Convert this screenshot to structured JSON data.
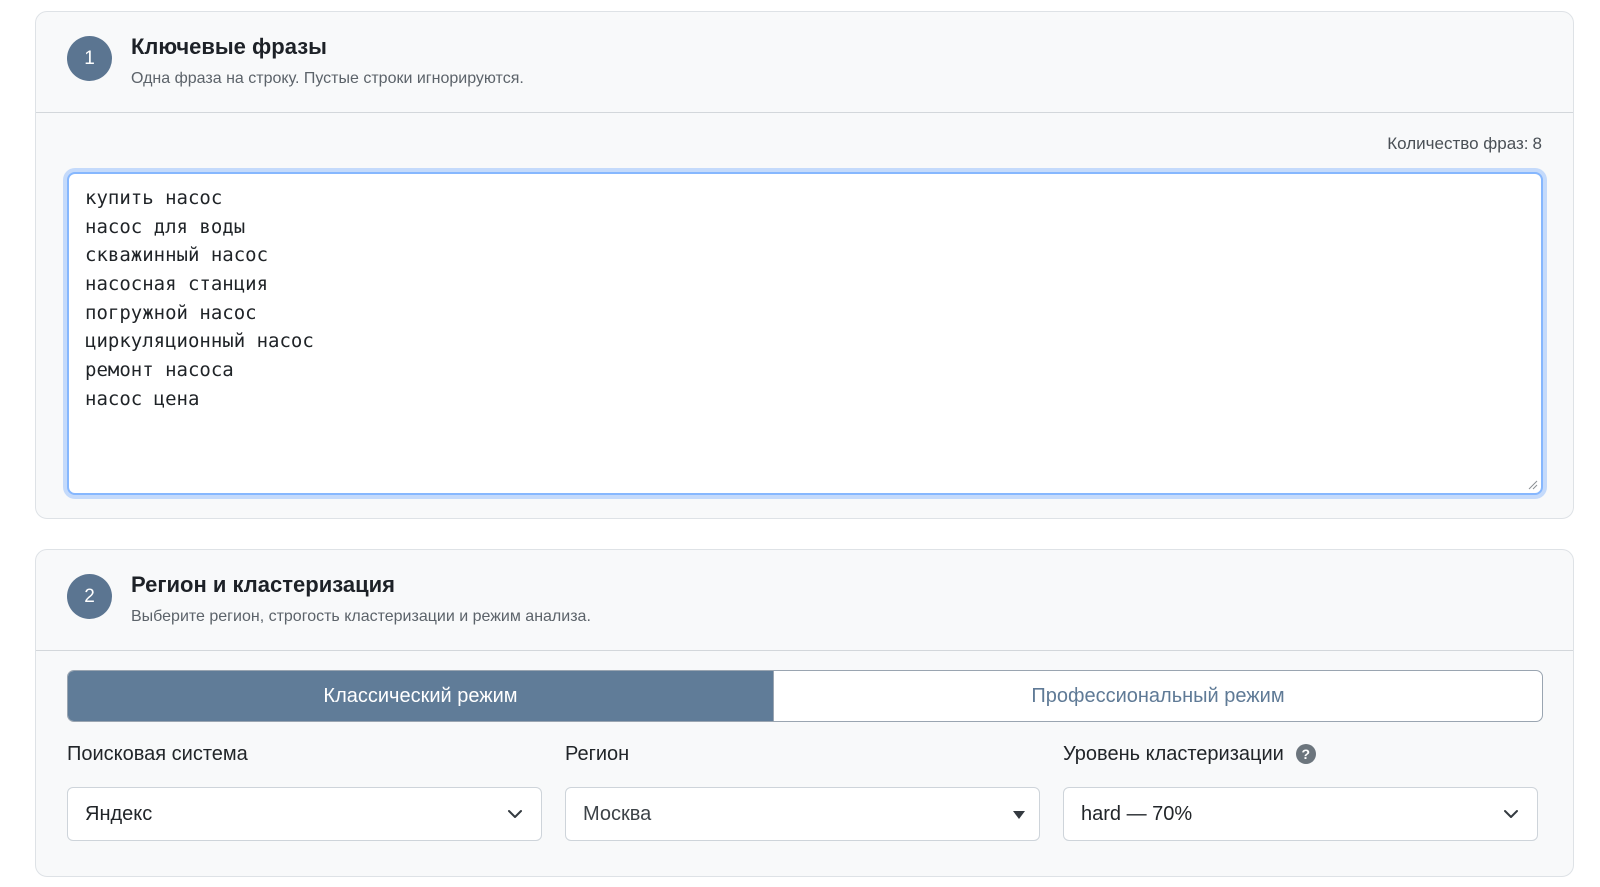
{
  "section1": {
    "step": "1",
    "title": "Ключевые фразы",
    "subtitle": "Одна фраза на строку. Пустые строки игнорируются.",
    "count_label": "Количество фраз:",
    "count_value": "8",
    "phrases": [
      "купить насос",
      "насос для воды",
      "скважинный насос",
      "насосная станция",
      "погружной насос",
      "циркуляционный насос",
      "ремонт насоса",
      "насос цена"
    ]
  },
  "section2": {
    "step": "2",
    "title": "Регион и кластеризация",
    "subtitle": "Выберите регион, строгость кластеризации и режим анализа.",
    "tabs": [
      {
        "label": "Классический режим",
        "active": true
      },
      {
        "label": "Профессиональный режим",
        "active": false
      }
    ],
    "search_engine": {
      "label": "Поисковая система",
      "value": "Яндекс",
      "icon": "chevron-down-icon"
    },
    "region": {
      "label": "Регион",
      "value": "Москва",
      "icon": "caret-down-icon"
    },
    "cluster_level": {
      "label": "Уровень кластеризации",
      "value": "hard — 70%",
      "help_icon": "question-circle-icon",
      "icon": "chevron-down-icon"
    }
  },
  "colors": {
    "accent": "#607c98",
    "badge": "#5b7591",
    "focus": "#86b7fe"
  }
}
